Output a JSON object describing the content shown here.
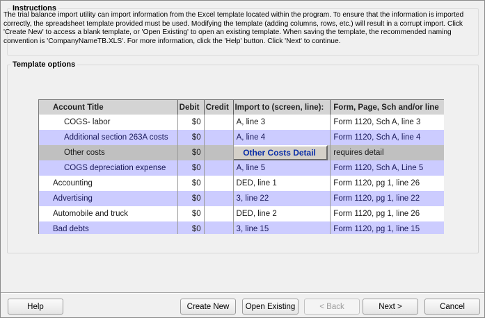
{
  "instructions": {
    "title": "Instructions",
    "text": "The trial balance import utility can import information from the Excel template located within the program. To ensure that the information is imported correctly, the spreadsheet template provided must be used. Modifying the template (adding columns, rows, etc.) will result in a corrupt import. Click 'Create New' to access a blank template, or 'Open Existing' to open an existing template. When saving the template, the recommended naming convention is 'CompanyNameTB.XLS'. For more information, click the 'Help' button. Click 'Next' to continue."
  },
  "template_options": {
    "title": "Template options"
  },
  "grid": {
    "columns": [
      "Account Title",
      "Debit",
      "Credit",
      "Import to (screen, line):",
      "Form, Page, Sch and/or line"
    ],
    "rows": [
      {
        "title": "COGS- labor",
        "debit": "$0",
        "credit": "",
        "import": "A, line 3",
        "form": "Form 1120, Sch A, line 3"
      },
      {
        "title": "Additional section 263A costs",
        "debit": "$0",
        "credit": "",
        "import": "A, line 4",
        "form": "Form 1120, Sch A, line 4"
      },
      {
        "title": "Other costs",
        "debit": "$0",
        "credit": "",
        "import_button": "Other Costs Detail",
        "form": "requires detail"
      },
      {
        "title": "COGS depreciation expense",
        "debit": "$0",
        "credit": "",
        "import": "A, line 5",
        "form": "Form 1120, Sch A, Line 5"
      },
      {
        "title": "Accounting",
        "debit": "$0",
        "credit": "",
        "import": "DED, line 1",
        "form": "Form 1120, pg 1, line 26"
      },
      {
        "title": "Advertising",
        "debit": "$0",
        "credit": "",
        "import": "3, line 22",
        "form": "Form 1120, pg 1, line 22"
      },
      {
        "title": "Automobile and truck",
        "debit": "$0",
        "credit": "",
        "import": "DED, line 2",
        "form": "Form 1120, pg 1, line 26"
      },
      {
        "title": "Bad debts",
        "debit": "$0",
        "credit": "",
        "import": "3, line 15",
        "form": "Form 1120, pg 1, line 15"
      }
    ]
  },
  "buttons": {
    "help": "Help",
    "create_new": "Create New",
    "open_existing": "Open Existing",
    "back": "< Back",
    "next": "Next >",
    "cancel": "Cancel"
  }
}
